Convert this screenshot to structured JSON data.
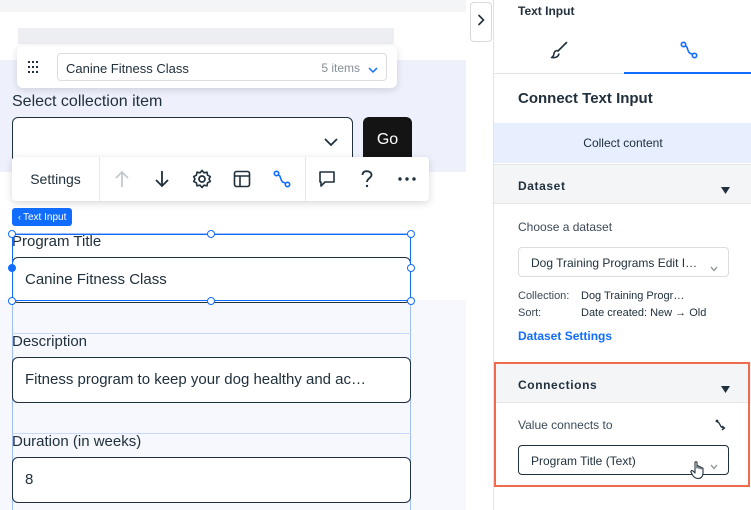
{
  "canvas": {
    "navigator": {
      "selected": "Canine Fitness Class",
      "count": "5 items"
    },
    "collection_label": "Select collection item",
    "go_label": "Go",
    "toolbar": {
      "settings_label": "Settings",
      "icons": [
        "arrow-up-icon",
        "arrow-down-icon",
        "gear-icon",
        "layout-icon",
        "connect-data-icon",
        "comment-icon",
        "help-icon",
        "more-icon"
      ]
    },
    "element_tag": "Text Input",
    "fields": [
      {
        "label": "Program Title",
        "value": "Canine Fitness Class"
      },
      {
        "label": "Description",
        "value": "Fitness program to keep your dog healthy and ac…"
      },
      {
        "label": "Duration (in weeks)",
        "value": "8"
      }
    ]
  },
  "panel": {
    "title": "Text Input",
    "tabs": [
      "design-tab",
      "connect-tab"
    ],
    "heading": "Connect Text Input",
    "mode": "Collect content",
    "dataset_section": {
      "title": "Dataset",
      "choose_label": "Choose a dataset",
      "choose_value": "Dog Training Programs Edit I…",
      "collection_key": "Collection:",
      "collection_value": "Dog Training Progr…",
      "sort_key": "Sort:",
      "sort_value": "Date created: New → Old",
      "settings_link": "Dataset Settings"
    },
    "connections_section": {
      "title": "Connections",
      "value_label": "Value connects to",
      "value_selected": "Program Title (Text)"
    }
  },
  "colors": {
    "accent": "#116dff",
    "highlight": "#ee6c4d",
    "go_button": "#151414"
  }
}
